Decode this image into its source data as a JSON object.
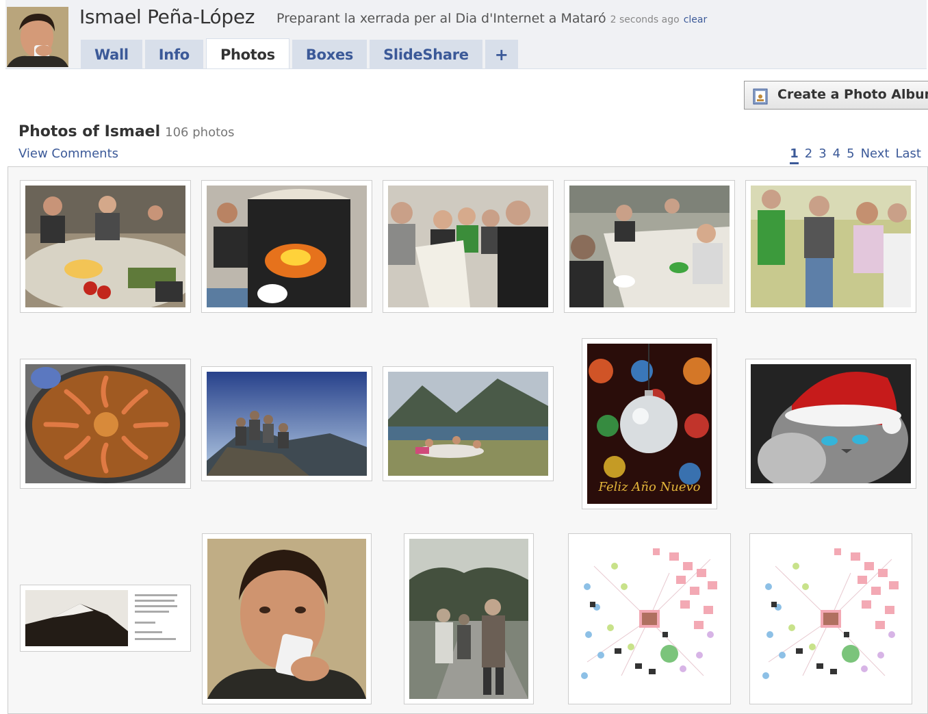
{
  "profile": {
    "name": "Ismael Peña-López",
    "status": "Preparant la xerrada per al Dia d'Internet a Mataró",
    "status_time": "2 seconds ago",
    "clear_label": "clear"
  },
  "tabs": [
    {
      "label": "Wall"
    },
    {
      "label": "Info"
    },
    {
      "label": "Photos"
    },
    {
      "label": "Boxes"
    },
    {
      "label": "SlideShare"
    },
    {
      "label": "+"
    }
  ],
  "toolbar": {
    "create_album_label": "Create a Photo Album"
  },
  "section": {
    "title": "Photos of Ismael",
    "count": "106 photos",
    "view_comments": "View Comments"
  },
  "pager": {
    "pages": [
      "1",
      "2",
      "3",
      "4",
      "5"
    ],
    "next": "Next",
    "last": "Last",
    "current": "1"
  },
  "photos": [
    {
      "subject": "dinner-table"
    },
    {
      "subject": "fireplace-cooking"
    },
    {
      "subject": "group-reading"
    },
    {
      "subject": "long-dinner"
    },
    {
      "subject": "friends-standing"
    },
    {
      "subject": "paella"
    },
    {
      "subject": "mountain-group"
    },
    {
      "subject": "lake-picnic"
    },
    {
      "subject": "christmas-ornament",
      "caption": "Feliz Año Nuevo"
    },
    {
      "subject": "cat-santa-hat"
    },
    {
      "subject": "snowy-mountain-document"
    },
    {
      "subject": "portrait-drinking"
    },
    {
      "subject": "hikers-path"
    },
    {
      "subject": "friends-network-graph"
    },
    {
      "subject": "friends-network-graph"
    }
  ],
  "colors": {
    "link": "#3b5998",
    "tab_bg": "#d8dfea",
    "header_bg": "#f0f1f4",
    "grid_bg": "#f7f7f7"
  }
}
